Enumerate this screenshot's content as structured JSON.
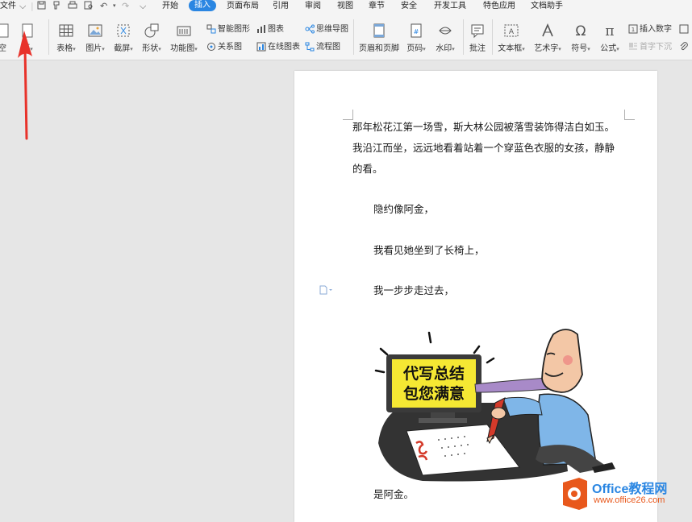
{
  "menubar": {
    "file_label": "文件",
    "tabs": [
      "开始",
      "插入",
      "页面布局",
      "引用",
      "审阅",
      "视图",
      "章节",
      "安全",
      "开发工具",
      "特色应用",
      "文档助手"
    ],
    "active_tab": "插入"
  },
  "ribbon": {
    "partial_label": "空",
    "blank_page": "页",
    "table": "表格",
    "picture": "图片",
    "screenshot": "截屏",
    "shape": "形状",
    "function_chart": "功能图",
    "smart_art": "智能图形",
    "relation": "关系图",
    "chart": "图表",
    "online_chart": "在线图表",
    "mind_map": "思维导图",
    "flow_chart": "流程图",
    "header_footer": "页眉和页脚",
    "page_number": "页码",
    "watermark": "水印",
    "comment": "批注",
    "textbox": "文本框",
    "art_text": "艺术字",
    "symbol": "符号",
    "formula": "公式",
    "insert_number": "插入数字",
    "drop_cap": "首字下沉"
  },
  "document": {
    "lines": [
      "那年松花江第一场雪，斯大林公园被落雪装饰得洁白如玉。",
      "我沿江而坐，远远地看着站着一个穿蓝色衣服的女孩，静静",
      "的看。"
    ],
    "para2": "隐约像阿金，",
    "para3": "我看见她坐到了长椅上，",
    "para4": "我一步步走过去，",
    "cartoon_text_line1": "代写总结",
    "cartoon_text_line2": "包您满意",
    "last_line": "是阿金。"
  },
  "watermark": {
    "brand": "Office教程网",
    "url": "www.office26.com"
  },
  "colors": {
    "accent": "#2a86e2",
    "arrow": "#e8322a",
    "watermark_orange": "#e8581c"
  }
}
